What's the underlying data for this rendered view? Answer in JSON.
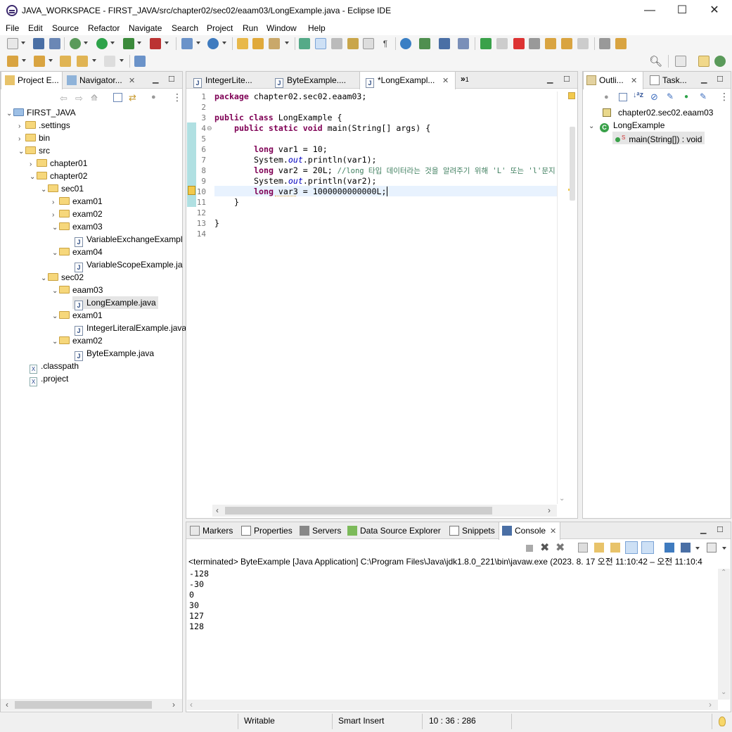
{
  "window": {
    "title": "JAVA_WORKSPACE - FIRST_JAVA/src/chapter02/sec02/eaam03/LongExample.java - Eclipse IDE",
    "minimize": "—",
    "maximize": "☐",
    "close": "✕"
  },
  "menu": [
    "File",
    "Edit",
    "Source",
    "Refactor",
    "Navigate",
    "Search",
    "Project",
    "Run",
    "Window",
    "Help"
  ],
  "left_panel": {
    "tabs": [
      "Project E...",
      "Navigator..."
    ],
    "tree": [
      {
        "label": "FIRST_JAVA",
        "kind": "project",
        "expanded": true
      },
      {
        "label": ".settings",
        "kind": "folder",
        "expanded": false
      },
      {
        "label": "bin",
        "kind": "folder",
        "expanded": false
      },
      {
        "label": "src",
        "kind": "folder",
        "expanded": true
      },
      {
        "label": "chapter01",
        "kind": "folder",
        "expanded": false
      },
      {
        "label": "chapter02",
        "kind": "folder",
        "expanded": true
      },
      {
        "label": "sec01",
        "kind": "folder",
        "expanded": true
      },
      {
        "label": "exam01",
        "kind": "folder",
        "expanded": false
      },
      {
        "label": "exam02",
        "kind": "folder",
        "expanded": false
      },
      {
        "label": "exam03",
        "kind": "folder",
        "expanded": true
      },
      {
        "label": "VariableExchangeExampl",
        "kind": "java"
      },
      {
        "label": "exam04",
        "kind": "folder",
        "expanded": true
      },
      {
        "label": "VariableScopeExample.ja",
        "kind": "java"
      },
      {
        "label": "sec02",
        "kind": "folder",
        "expanded": true
      },
      {
        "label": "eaam03",
        "kind": "folder",
        "expanded": true
      },
      {
        "label": "LongExample.java",
        "kind": "java",
        "selected": true
      },
      {
        "label": "exam01",
        "kind": "folder",
        "expanded": true
      },
      {
        "label": "IntegerLiteralExample.java",
        "kind": "java"
      },
      {
        "label": "exam02",
        "kind": "folder",
        "expanded": true
      },
      {
        "label": "ByteExample.java",
        "kind": "java"
      },
      {
        "label": ".classpath",
        "kind": "xml"
      },
      {
        "label": ".project",
        "kind": "xml"
      }
    ]
  },
  "editor": {
    "tabs": [
      "IntegerLite...",
      "ByteExample....",
      "*LongExampl..."
    ],
    "overflow_count": "1",
    "line_numbers": [
      "1",
      "2",
      "3",
      "4",
      "5",
      "6",
      "7",
      "8",
      "9",
      "10",
      "11",
      "12",
      "13",
      "14"
    ],
    "code": {
      "l1_kw": "package",
      "l1_rest": " chapter02.sec02.eaam03;",
      "l3_kw": "public class",
      "l3_rest": " LongExample {",
      "l4_kw": "public static void",
      "l4_rest": " main(String[] args) {",
      "l6_kw": "long",
      "l6_rest": " var1 = 10;",
      "l7_a": "System.",
      "l7_fld": "out",
      "l7_b": ".println(var1);",
      "l8_kw": "long",
      "l8_rest": " var2 = 20L; ",
      "l8_cm": "//long 타입 데이터라는 것을 알려주기 위해 'L' 또는 'l'문지",
      "l9_a": "System.",
      "l9_fld": "out",
      "l9_b": ".println(var2);",
      "l10_kw": "long",
      "l10_rest": " var3 = 1000000000000L;",
      "l11": "}",
      "l13": "}"
    }
  },
  "outline": {
    "tabs": [
      "Outli...",
      "Task..."
    ],
    "items": [
      {
        "label": "chapter02.sec02.eaam03",
        "kind": "package"
      },
      {
        "label": "LongExample",
        "kind": "class"
      },
      {
        "label": "main(String[]) : void",
        "kind": "method",
        "selected": true
      }
    ]
  },
  "bottom_panel": {
    "tabs": [
      "Markers",
      "Properties",
      "Servers",
      "Data Source Explorer",
      "Snippets",
      "Console"
    ],
    "console_header": "<terminated> ByteExample [Java Application] C:\\Program Files\\Java\\jdk1.8.0_221\\bin\\javaw.exe  (2023. 8. 17 오전 11:10:42 – 오전 11:10:4",
    "output": [
      "-128",
      "-30",
      "0",
      "30",
      "127",
      "128"
    ]
  },
  "status": {
    "mode": "Writable",
    "insert": "Smart Insert",
    "position": "10 : 36 : 286"
  }
}
